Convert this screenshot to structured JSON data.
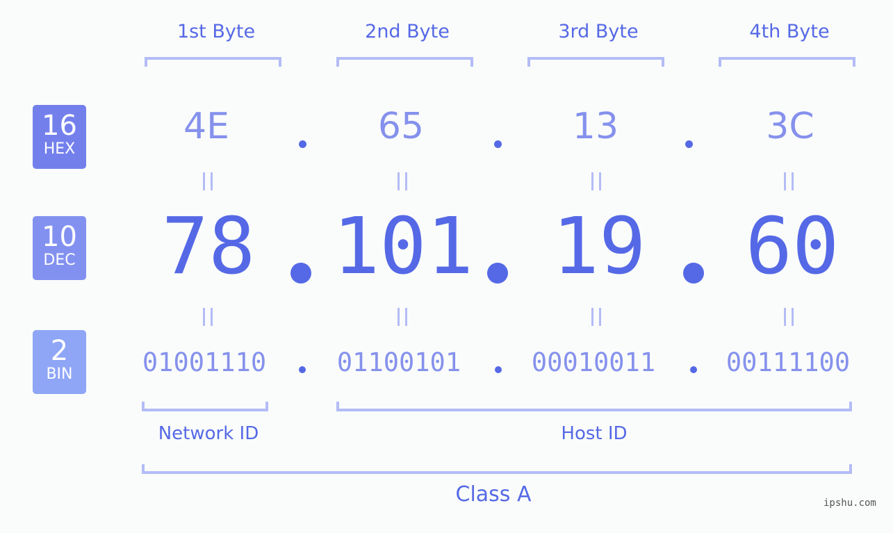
{
  "bytes": [
    {
      "label": "1st Byte",
      "hex": "4E",
      "dec": "78",
      "bin": "01001110"
    },
    {
      "label": "2nd Byte",
      "hex": "65",
      "dec": "101",
      "bin": "01100101"
    },
    {
      "label": "3rd Byte",
      "hex": "13",
      "dec": "19",
      "bin": "00010011"
    },
    {
      "label": "4th Byte",
      "hex": "3C",
      "dec": "60",
      "bin": "00111100"
    }
  ],
  "badges": {
    "hex": {
      "base": "16",
      "name": "HEX",
      "color": "#7380ec"
    },
    "dec": {
      "base": "10",
      "name": "DEC",
      "color": "#8291f0"
    },
    "bin": {
      "base": "2",
      "name": "BIN",
      "color": "#8fa6f6"
    }
  },
  "segments": {
    "network_id": "Network ID",
    "host_id": "Host ID",
    "class": "Class A"
  },
  "watermark": "ipshu.com",
  "colors": {
    "primary": "#5569e6",
    "secondary": "#8591ec",
    "bracket": "#b3bcf6",
    "background": "#fafcfb"
  }
}
